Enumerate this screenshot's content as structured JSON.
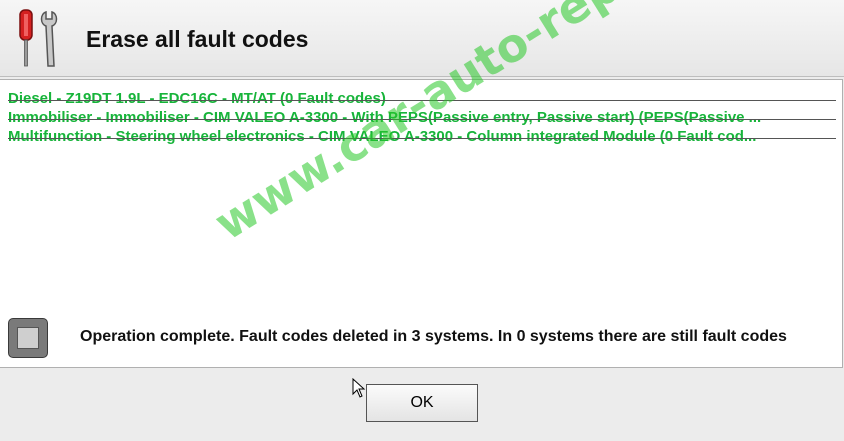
{
  "dialog": {
    "title": "Erase all fault codes",
    "icon": "tools-icon"
  },
  "systems": [
    "Diesel - Z19DT 1.9L - EDC16C - MT/AT (0 Fault codes)",
    "Immobiliser - Immobiliser - CIM VALEO A-3300 - With PEPS(Passive entry, Passive start) (PEPS(Passive ...",
    "Multifunction - Steering wheel electronics - CIM VALEO A-3300 - Column integrated Module (0 Fault cod..."
  ],
  "status": {
    "message": "Operation complete. Fault codes deleted in 3 systems. In 0 systems there are still fault codes"
  },
  "buttons": {
    "ok_label": "OK"
  },
  "watermark": "www.car-auto-repair.com",
  "colors": {
    "system_text": "#17b43a",
    "watermark": "#28c828"
  }
}
